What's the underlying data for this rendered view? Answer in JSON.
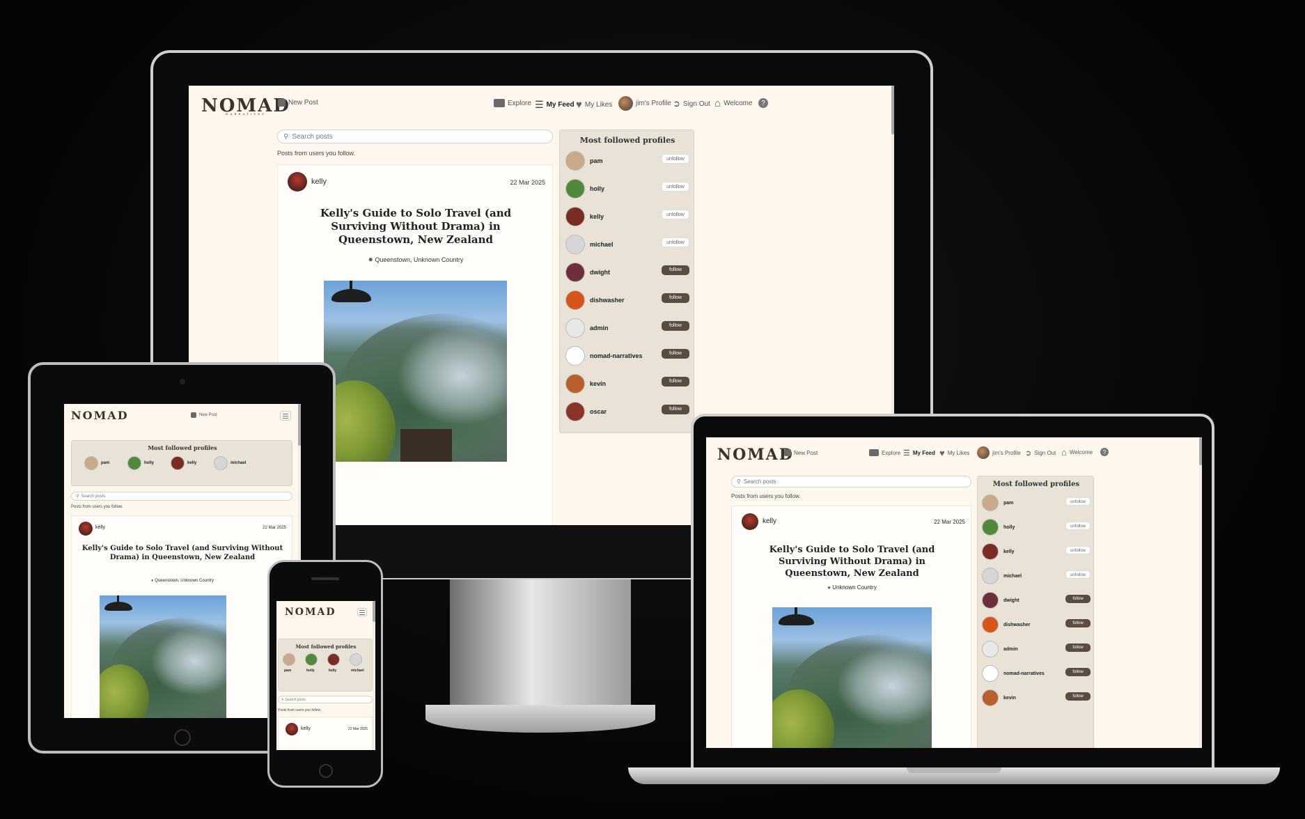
{
  "brand": {
    "logo": "NOMAD",
    "logo_sub": "NARRATIVES"
  },
  "nav": {
    "new_post": "New Post",
    "explore": "Explore",
    "my_feed": "My Feed",
    "my_likes": "My Likes",
    "profile": "jim's Profile",
    "sign_out": "Sign Out",
    "welcome": "Welcome",
    "help": "?"
  },
  "search": {
    "placeholder": "Search posts"
  },
  "feed": {
    "subtitle": "Posts from users you follow."
  },
  "post": {
    "author": "kelly",
    "date": "22 Mar 2025",
    "title": "Kelly's Guide to Solo Travel (and Surviving Without Drama) in Queenstown, New Zealand",
    "location": "Queenstown, Unknown Country",
    "location_laptop": "Unknown Country"
  },
  "sidebar": {
    "title": "Most followed profiles",
    "profiles": [
      {
        "name": "pam",
        "action": "unfollow",
        "color": "#c9a98a"
      },
      {
        "name": "holly",
        "action": "unfollow",
        "color": "#4f8a3a"
      },
      {
        "name": "kelly",
        "action": "unfollow",
        "color": "#7a2b22"
      },
      {
        "name": "michael",
        "action": "unfollow",
        "color": "#d6d6d6"
      },
      {
        "name": "dwight",
        "action": "follow",
        "color": "#6e2f3a"
      },
      {
        "name": "dishwasher",
        "action": "follow",
        "color": "#d7541a"
      },
      {
        "name": "admin",
        "action": "follow",
        "color": "#e8e8e8"
      },
      {
        "name": "nomad-narratives",
        "action": "follow",
        "color": "#ffffff"
      },
      {
        "name": "kevin",
        "action": "follow",
        "color": "#b85f2b"
      },
      {
        "name": "oscar",
        "action": "follow",
        "color": "#8a3328"
      }
    ]
  },
  "colors": {
    "page_bg": "#fdf7ee",
    "sidebar_bg": "#e9e2d7",
    "follow_btn": "#5b4c42"
  }
}
